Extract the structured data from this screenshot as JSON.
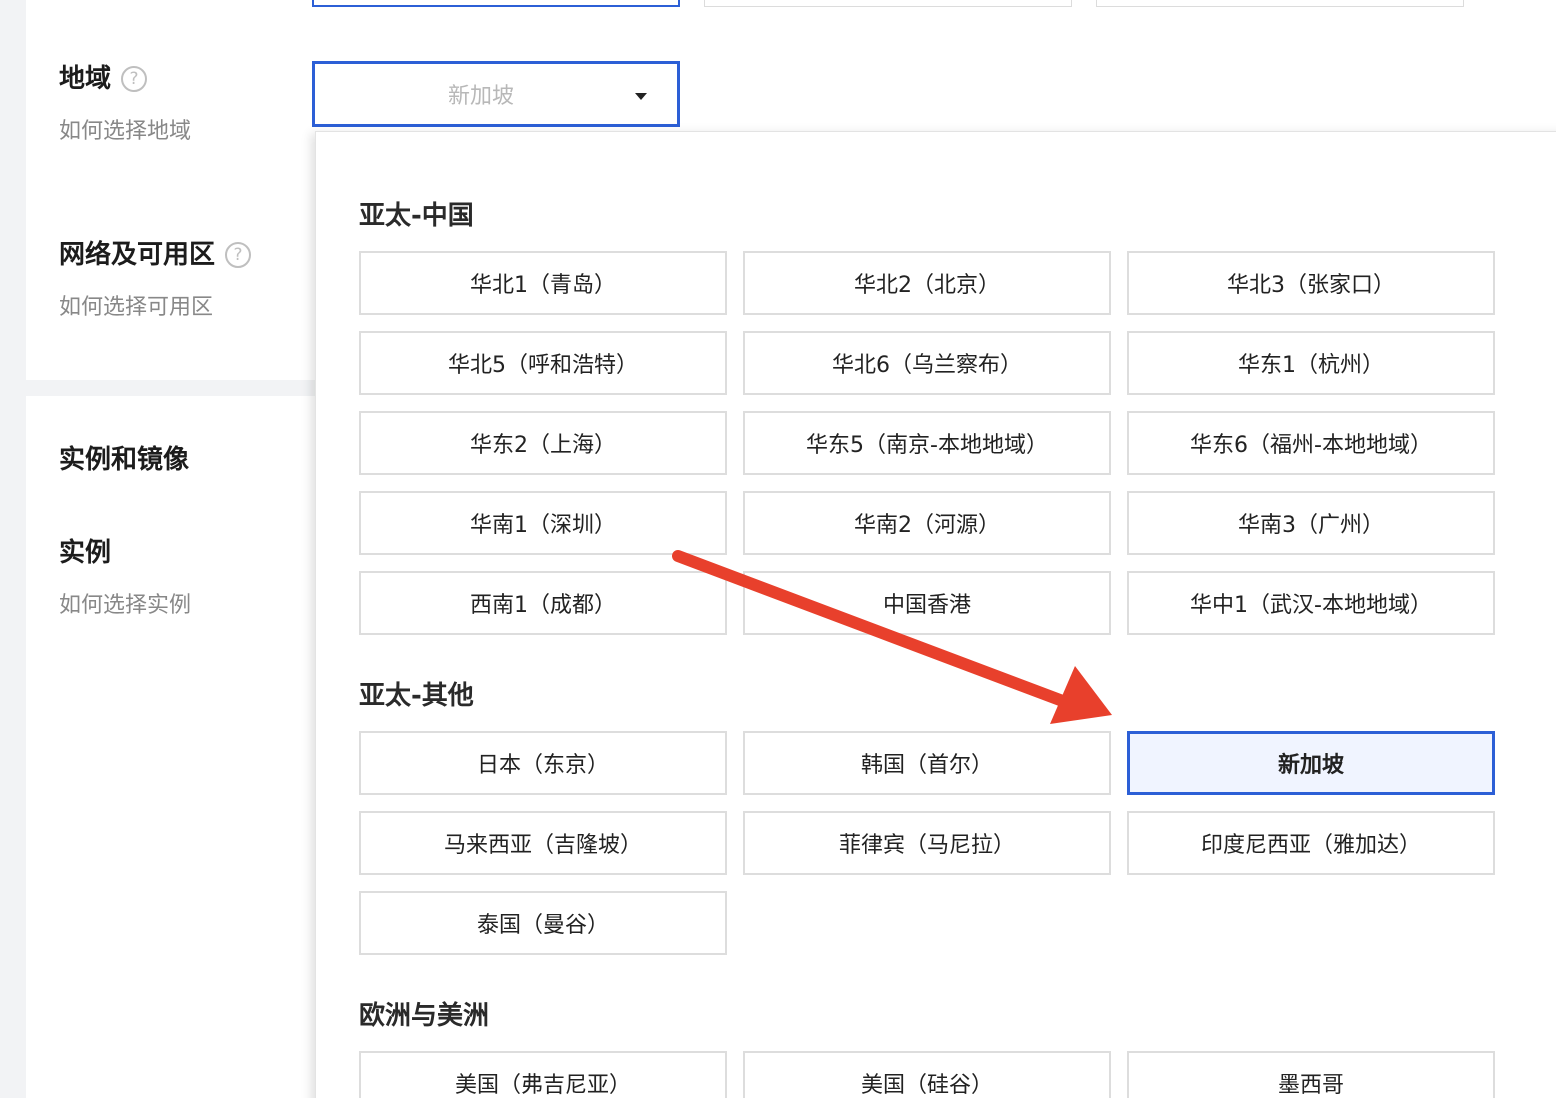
{
  "form": {
    "region": {
      "label": "地域",
      "help_link": "如何选择地域",
      "selected_value": "新加坡"
    },
    "network": {
      "label": "网络及可用区",
      "help_link": "如何选择可用区"
    },
    "instance_image": {
      "label": "实例和镜像"
    },
    "instance": {
      "label": "实例",
      "help_link": "如何选择实例"
    }
  },
  "help_icon_glyph": "?",
  "dropdown": {
    "groups": [
      {
        "title": "亚太-中国",
        "options": [
          "华北1（青岛）",
          "华北2（北京）",
          "华北3（张家口）",
          "华北5（呼和浩特）",
          "华北6（乌兰察布）",
          "华东1（杭州）",
          "华东2（上海）",
          "华东5（南京-本地地域）",
          "华东6（福州-本地地域）",
          "华南1（深圳）",
          "华南2（河源）",
          "华南3（广州）",
          "西南1（成都）",
          "中国香港",
          "华中1（武汉-本地地域）"
        ]
      },
      {
        "title": "亚太-其他",
        "options": [
          "日本（东京）",
          "韩国（首尔）",
          "新加坡",
          "马来西亚（吉隆坡）",
          "菲律宾（马尼拉）",
          "印度尼西亚（雅加达）",
          "泰国（曼谷）"
        ]
      },
      {
        "title": "欧洲与美洲",
        "options": [
          "美国（弗吉尼亚）",
          "美国（硅谷）",
          "墨西哥"
        ]
      }
    ],
    "selected_option": "新加坡"
  },
  "colors": {
    "accent": "#2c5fd6",
    "annotation_arrow": "#e8402c"
  },
  "icons": {
    "help": "question-circle-icon",
    "caret": "caret-down-icon",
    "annotation": "red-arrow-annotation"
  }
}
